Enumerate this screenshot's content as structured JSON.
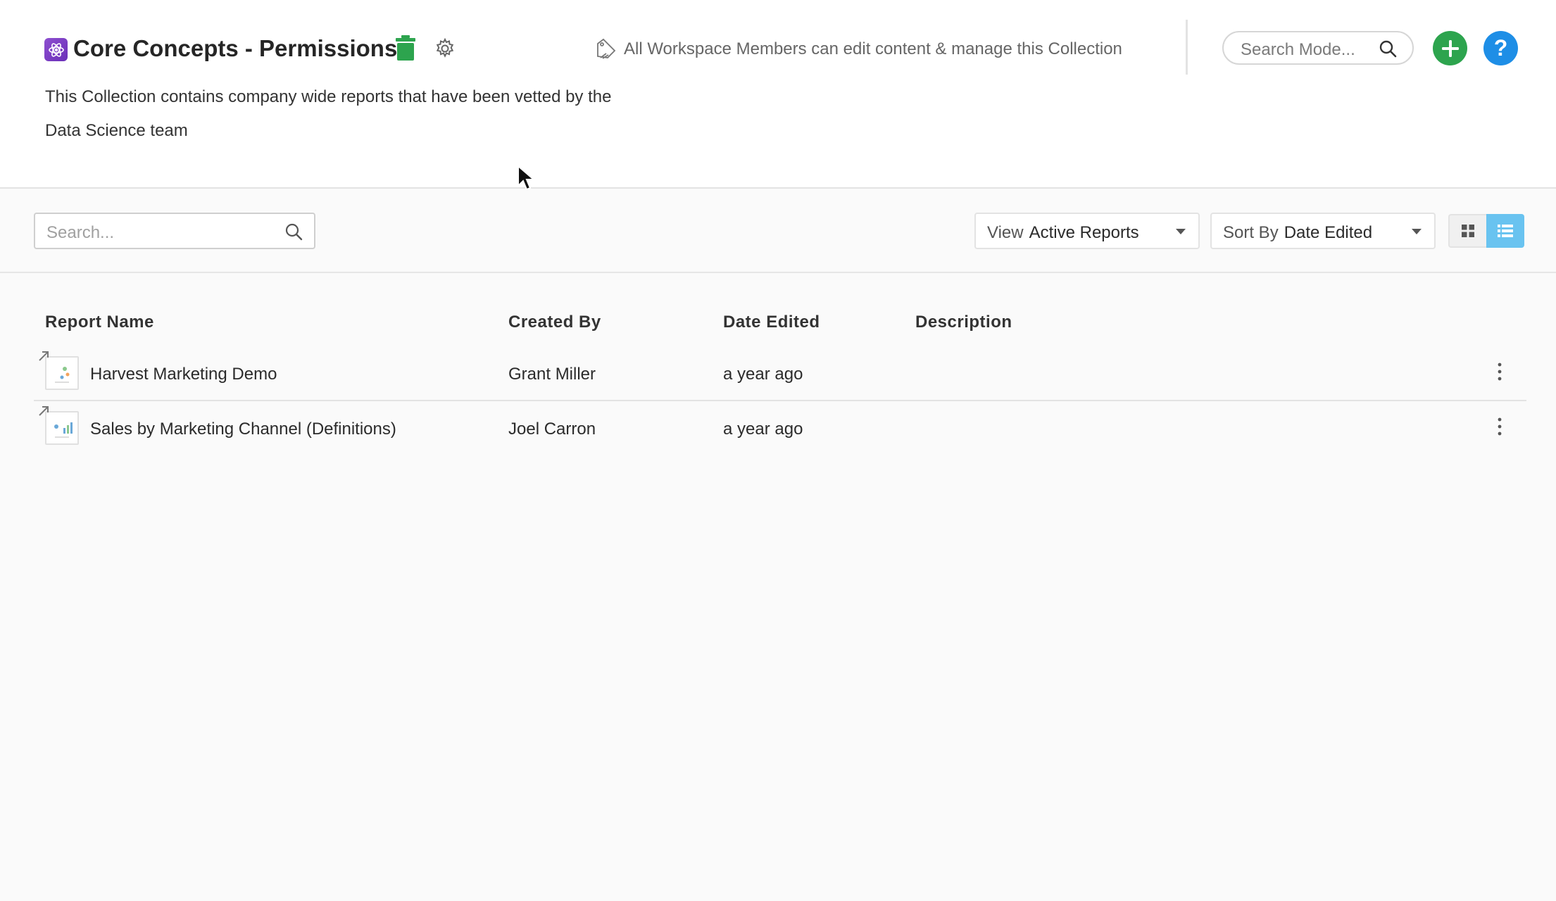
{
  "header": {
    "title": "Core Concepts - Permissions",
    "permission_text": "All Workspace Members can edit content & manage this Collection",
    "description_line1": "This Collection contains company wide reports that have been vetted by the",
    "description_line2": "Data Science team",
    "model_search_placeholder": "Search Mode...",
    "help_label": "?"
  },
  "toolbar": {
    "search_placeholder": "Search...",
    "view_label": "View",
    "view_value": "Active Reports",
    "sort_label": "Sort By",
    "sort_value": "Date Edited",
    "active_layout": "list"
  },
  "table": {
    "columns": [
      "Report Name",
      "Created By",
      "Date Edited",
      "Description"
    ],
    "rows": [
      {
        "name": "Harvest Marketing Demo",
        "created_by": "Grant Miller",
        "date_edited": "a year ago",
        "description": ""
      },
      {
        "name": "Sales by Marketing Channel (Definitions)",
        "created_by": "Joel Carron",
        "date_edited": "a year ago",
        "description": ""
      }
    ]
  },
  "colors": {
    "collection_icon": "#7b3fc4",
    "trash_icon": "#2da44e",
    "add_button": "#2da44e",
    "help_button": "#1e8ee6",
    "list_toggle_active": "#69c3f0"
  },
  "icons": [
    "collection-icon",
    "trash-icon",
    "gear-icon",
    "permission-icon",
    "search-icon",
    "plus-icon",
    "help-icon",
    "grid-view-icon",
    "list-view-icon",
    "report-thumbnail-icon",
    "shortcut-arrow-icon",
    "kebab-menu-icon",
    "mouse-cursor-icon"
  ]
}
